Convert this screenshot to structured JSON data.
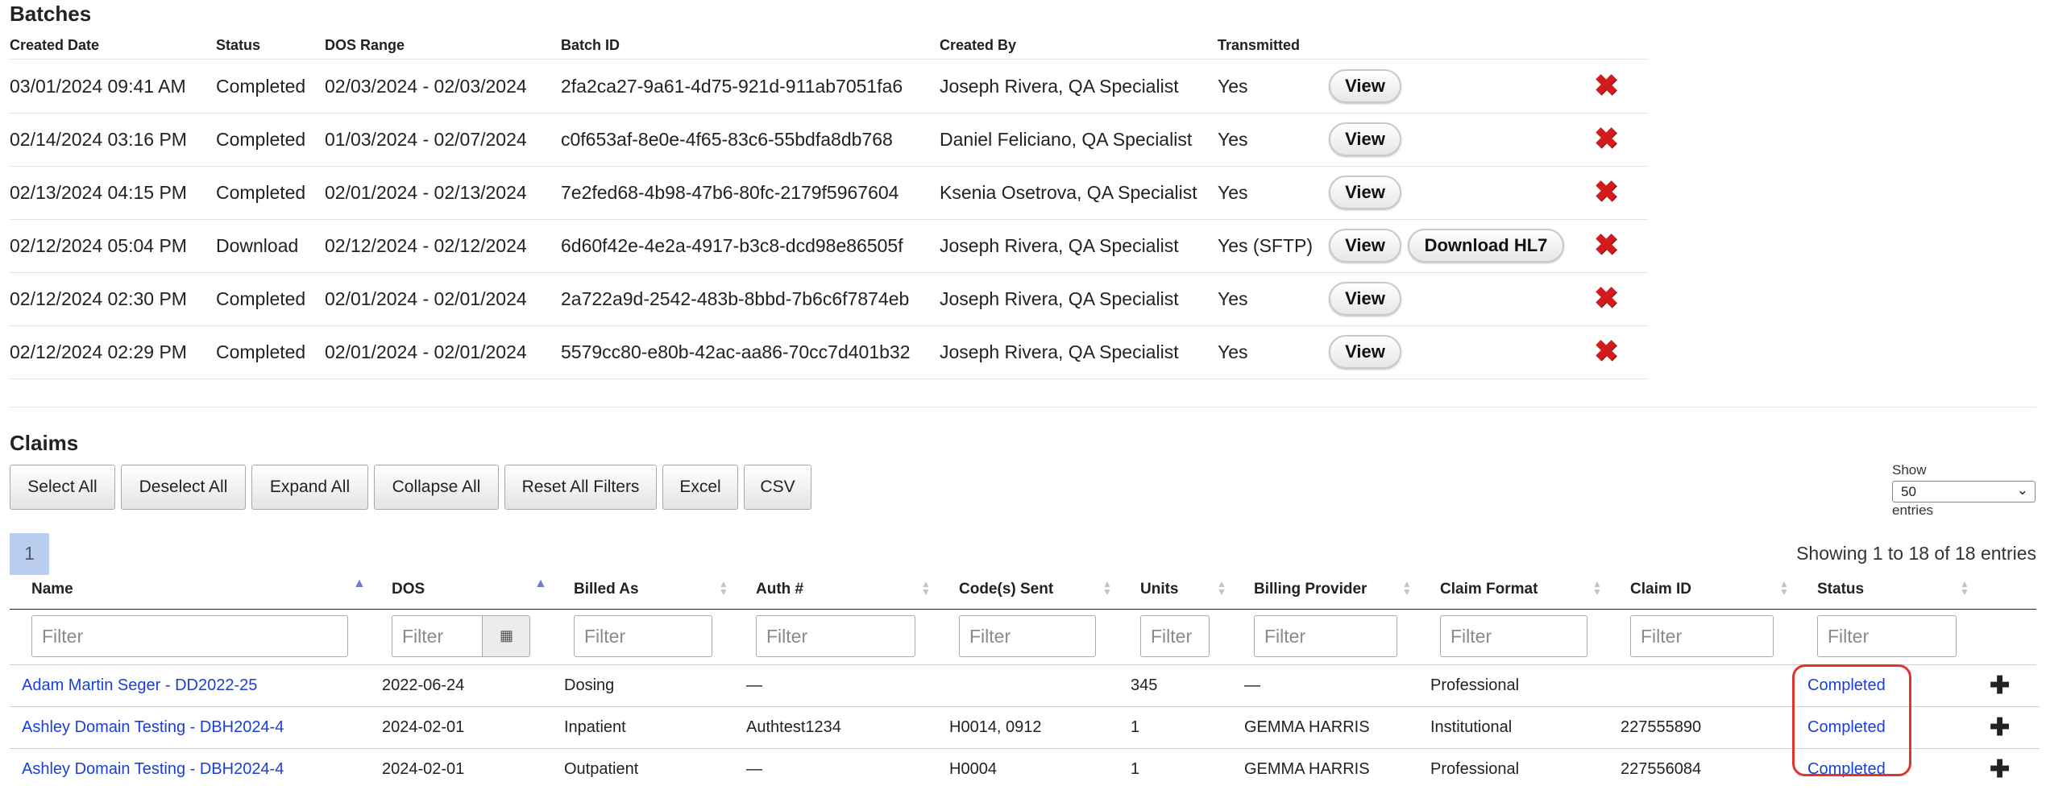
{
  "batches": {
    "title": "Batches",
    "columns": [
      "Created Date",
      "Status",
      "DOS Range",
      "Batch ID",
      "Created By",
      "Transmitted"
    ],
    "view_label": "View",
    "delete_icon": "close-x-icon",
    "rows": [
      {
        "created": "03/01/2024 09:41 AM",
        "status": "Completed",
        "dos": "02/03/2024 - 02/03/2024",
        "batch_id": "2fa2ca27-9a61-4d75-921d-911ab7051fa6",
        "by": "Joseph Rivera, QA Specialist",
        "transmitted": "Yes",
        "extra": ""
      },
      {
        "created": "02/14/2024 03:16 PM",
        "status": "Completed",
        "dos": "01/03/2024 - 02/07/2024",
        "batch_id": "c0f653af-8e0e-4f65-83c6-55bdfa8db768",
        "by": "Daniel Feliciano, QA Specialist",
        "transmitted": "Yes",
        "extra": ""
      },
      {
        "created": "02/13/2024 04:15 PM",
        "status": "Completed",
        "dos": "02/01/2024 - 02/13/2024",
        "batch_id": "7e2fed68-4b98-47b6-80fc-2179f5967604",
        "by": "Ksenia Osetrova, QA Specialist",
        "transmitted": "Yes",
        "extra": ""
      },
      {
        "created": "02/12/2024 05:04 PM",
        "status": "Download",
        "dos": "02/12/2024 - 02/12/2024",
        "batch_id": "6d60f42e-4e2a-4917-b3c8-dcd98e86505f",
        "by": "Joseph Rivera, QA Specialist",
        "transmitted": "Yes (SFTP)",
        "extra": "Download HL7"
      },
      {
        "created": "02/12/2024 02:30 PM",
        "status": "Completed",
        "dos": "02/01/2024 - 02/01/2024",
        "batch_id": "2a722a9d-2542-483b-8bbd-7b6c6f7874eb",
        "by": "Joseph Rivera, QA Specialist",
        "transmitted": "Yes",
        "extra": ""
      },
      {
        "created": "02/12/2024 02:29 PM",
        "status": "Completed",
        "dos": "02/01/2024 - 02/01/2024",
        "batch_id": "5579cc80-e80b-42ac-aa86-70cc7d401b32",
        "by": "Joseph Rivera, QA Specialist",
        "transmitted": "Yes",
        "extra": ""
      }
    ]
  },
  "claims": {
    "title": "Claims",
    "buttons": [
      "Select All",
      "Deselect All",
      "Expand All",
      "Collapse All",
      "Reset All Filters",
      "Excel",
      "CSV"
    ],
    "show": {
      "label_top": "Show",
      "value": "50",
      "label_bottom": "entries"
    },
    "page": "1",
    "info": "Showing 1 to 18 of 18 entries",
    "columns": [
      "Name",
      "DOS",
      "Billed As",
      "Auth #",
      "Code(s) Sent",
      "Units",
      "Billing Provider",
      "Claim Format",
      "Claim ID",
      "Status"
    ],
    "filter_placeholder": "Filter",
    "calendar_icon": "calendar-icon",
    "expand_icon": "plus-icon",
    "highlight_color": "#e0342f",
    "rows": [
      {
        "name": "Adam Martin Seger - DD2022-25",
        "dos": "2022-06-24",
        "billed_as": "Dosing",
        "auth": "—",
        "codes": "",
        "units": "345",
        "provider": "—",
        "format": "Professional",
        "claim_id": "",
        "status": "Completed"
      },
      {
        "name": "Ashley Domain Testing - DBH2024-4",
        "dos": "2024-02-01",
        "billed_as": "Inpatient",
        "auth": "Authtest1234",
        "codes": "H0014, 0912",
        "units": "1",
        "provider": "GEMMA HARRIS",
        "format": "Institutional",
        "claim_id": "227555890",
        "status": "Completed"
      },
      {
        "name": "Ashley Domain Testing - DBH2024-4",
        "dos": "2024-02-01",
        "billed_as": "Outpatient",
        "auth": "—",
        "codes": "H0004",
        "units": "1",
        "provider": "GEMMA HARRIS",
        "format": "Professional",
        "claim_id": "227556084",
        "status": "Completed"
      }
    ]
  }
}
